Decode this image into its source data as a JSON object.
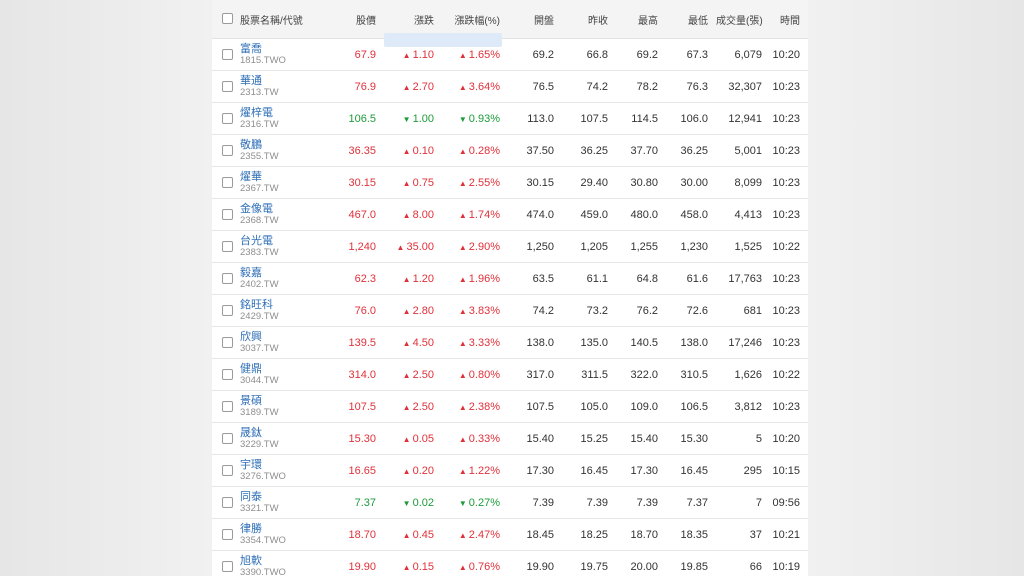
{
  "headers": [
    "股票名稱/代號",
    "股價",
    "漲跌",
    "漲跌幅(%)",
    "開盤",
    "昨收",
    "最高",
    "最低",
    "成交量(張)",
    "時間"
  ],
  "rows": [
    {
      "name": "富喬",
      "code": "1815.TWO",
      "price": "67.9",
      "change": "1.10",
      "pct": "1.65%",
      "dir": "up",
      "open": "69.2",
      "prev": "66.8",
      "high": "69.2",
      "low": "67.3",
      "vol": "6,079",
      "time": "10:20"
    },
    {
      "name": "華通",
      "code": "2313.TW",
      "price": "76.9",
      "change": "2.70",
      "pct": "3.64%",
      "dir": "up",
      "open": "76.5",
      "prev": "74.2",
      "high": "78.2",
      "low": "76.3",
      "vol": "32,307",
      "time": "10:23"
    },
    {
      "name": "燿梓電",
      "code": "2316.TW",
      "price": "106.5",
      "change": "1.00",
      "pct": "0.93%",
      "dir": "down",
      "open": "113.0",
      "prev": "107.5",
      "high": "114.5",
      "low": "106.0",
      "vol": "12,941",
      "time": "10:23"
    },
    {
      "name": "敬鵬",
      "code": "2355.TW",
      "price": "36.35",
      "change": "0.10",
      "pct": "0.28%",
      "dir": "up",
      "open": "37.50",
      "prev": "36.25",
      "high": "37.70",
      "low": "36.25",
      "vol": "5,001",
      "time": "10:23"
    },
    {
      "name": "燿華",
      "code": "2367.TW",
      "price": "30.15",
      "change": "0.75",
      "pct": "2.55%",
      "dir": "up",
      "open": "30.15",
      "prev": "29.40",
      "high": "30.80",
      "low": "30.00",
      "vol": "8,099",
      "time": "10:23"
    },
    {
      "name": "金像電",
      "code": "2368.TW",
      "price": "467.0",
      "change": "8.00",
      "pct": "1.74%",
      "dir": "up",
      "open": "474.0",
      "prev": "459.0",
      "high": "480.0",
      "low": "458.0",
      "vol": "4,413",
      "time": "10:23"
    },
    {
      "name": "台光電",
      "code": "2383.TW",
      "price": "1,240",
      "change": "35.00",
      "pct": "2.90%",
      "dir": "up",
      "open": "1,250",
      "prev": "1,205",
      "high": "1,255",
      "low": "1,230",
      "vol": "1,525",
      "time": "10:22"
    },
    {
      "name": "毅嘉",
      "code": "2402.TW",
      "price": "62.3",
      "change": "1.20",
      "pct": "1.96%",
      "dir": "up",
      "open": "63.5",
      "prev": "61.1",
      "high": "64.8",
      "low": "61.6",
      "vol": "17,763",
      "time": "10:23"
    },
    {
      "name": "銘旺科",
      "code": "2429.TW",
      "price": "76.0",
      "change": "2.80",
      "pct": "3.83%",
      "dir": "up",
      "open": "74.2",
      "prev": "73.2",
      "high": "76.2",
      "low": "72.6",
      "vol": "681",
      "time": "10:23"
    },
    {
      "name": "欣興",
      "code": "3037.TW",
      "price": "139.5",
      "change": "4.50",
      "pct": "3.33%",
      "dir": "up",
      "open": "138.0",
      "prev": "135.0",
      "high": "140.5",
      "low": "138.0",
      "vol": "17,246",
      "time": "10:23"
    },
    {
      "name": "健鼎",
      "code": "3044.TW",
      "price": "314.0",
      "change": "2.50",
      "pct": "0.80%",
      "dir": "up",
      "open": "317.0",
      "prev": "311.5",
      "high": "322.0",
      "low": "310.5",
      "vol": "1,626",
      "time": "10:22"
    },
    {
      "name": "景碩",
      "code": "3189.TW",
      "price": "107.5",
      "change": "2.50",
      "pct": "2.38%",
      "dir": "up",
      "open": "107.5",
      "prev": "105.0",
      "high": "109.0",
      "low": "106.5",
      "vol": "3,812",
      "time": "10:23"
    },
    {
      "name": "晟鈦",
      "code": "3229.TW",
      "price": "15.30",
      "change": "0.05",
      "pct": "0.33%",
      "dir": "up",
      "open": "15.40",
      "prev": "15.25",
      "high": "15.40",
      "low": "15.30",
      "vol": "5",
      "time": "10:20"
    },
    {
      "name": "宇環",
      "code": "3276.TWO",
      "price": "16.65",
      "change": "0.20",
      "pct": "1.22%",
      "dir": "up",
      "open": "17.30",
      "prev": "16.45",
      "high": "17.30",
      "low": "16.45",
      "vol": "295",
      "time": "10:15"
    },
    {
      "name": "同泰",
      "code": "3321.TW",
      "price": "7.37",
      "change": "0.02",
      "pct": "0.27%",
      "dir": "down",
      "open": "7.39",
      "prev": "7.39",
      "high": "7.39",
      "low": "7.37",
      "vol": "7",
      "time": "09:56"
    },
    {
      "name": "律勝",
      "code": "3354.TWO",
      "price": "18.70",
      "change": "0.45",
      "pct": "2.47%",
      "dir": "up",
      "open": "18.45",
      "prev": "18.25",
      "high": "18.70",
      "low": "18.35",
      "vol": "37",
      "time": "10:21"
    },
    {
      "name": "旭軟",
      "code": "3390.TWO",
      "price": "19.90",
      "change": "0.15",
      "pct": "0.76%",
      "dir": "up",
      "open": "19.90",
      "prev": "19.75",
      "high": "20.00",
      "low": "19.85",
      "vol": "66",
      "time": "10:19"
    }
  ],
  "colors": {
    "up": "#e0313a",
    "down": "#1c9b3a",
    "link": "#2f6fb7"
  }
}
